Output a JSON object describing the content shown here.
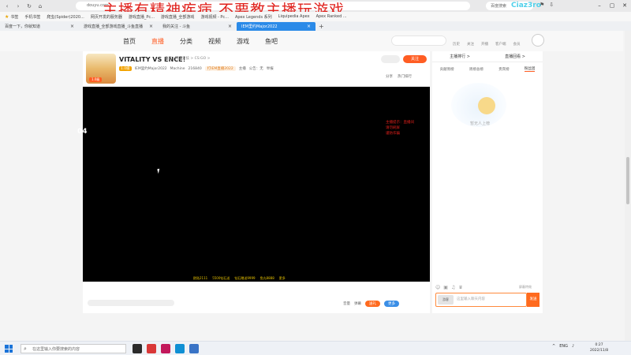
{
  "overlay": {
    "title": "主播有精神疾病 不要教主播玩游戏",
    "corner": "Ciaz3ro"
  },
  "browser": {
    "tabs": [
      {
        "label": "鼠标..."
      },
      {
        "label": "Apex Legends 系列"
      },
      {
        "label": "Liquipedia Apex"
      },
      {
        "label": "Apex Ranked ..."
      }
    ],
    "address": "douyu.com",
    "search_label": "百度搜索",
    "bookmarks": [
      {
        "label": "书签"
      },
      {
        "label": "手机书签"
      },
      {
        "label": "爬虫(Spider)2020..."
      },
      {
        "label": "网页开发的服务器"
      },
      {
        "label": "游戏直播_Pc..."
      },
      {
        "label": "游戏直播_全部游戏"
      },
      {
        "label": "游戏视频 - Pc..."
      },
      {
        "label": "Apex Legends 系列"
      },
      {
        "label": "Liquipedia Apex"
      },
      {
        "label": "Apex Ranked ..."
      }
    ],
    "page_tabs": [
      {
        "label": "百度一下，你就知道"
      },
      {
        "label": "游戏直播_全部游戏直播_斗鱼直播"
      },
      {
        "label": "我的关注 - 斗鱼"
      },
      {
        "label": "IEM里约Major2022"
      }
    ]
  },
  "site": {
    "nav": [
      "首页",
      "直播",
      "分类",
      "视频",
      "游戏",
      "鱼吧"
    ],
    "nav_active_index": 1,
    "links": [
      "历史",
      "关注",
      "开播",
      "客户端",
      "会员"
    ]
  },
  "room": {
    "title": "VITALITY VS ENCE！",
    "meta": [
      "体育",
      "网游竞技 > CS:GO >"
    ],
    "level": "1.0级",
    "streamer": "IEM里约Major2022",
    "company": "Machine",
    "fans": "216840",
    "pill": "打IEM直播2022",
    "stats": [
      "主播",
      "公告：无"
    ],
    "report": "举报",
    "follow": "关注",
    "share": "分享",
    "hot_ranking": "热门排行"
  },
  "player": {
    "red_note": [
      "主播提示：直播间",
      "请勿刷屏",
      "谨防诈骗"
    ],
    "ticker": [
      "欧陆2111",
      "5500钻石送",
      "钻石赠送9999",
      "鱼丸8888",
      "更多"
    ],
    "side_number": "04"
  },
  "controls": {
    "volume": "音量",
    "danmaku": "弹幕",
    "gift": "送礼",
    "more": "更多"
  },
  "rightpanel": {
    "top": [
      "主播排行 >",
      "直播回看 >"
    ],
    "tabs": [
      "贡献周榜",
      "周榜总榜",
      "贵宾榜",
      "粉丝团"
    ],
    "active_tab_index": 3,
    "empty_text": "暂无人上榜",
    "toggle": "屏蔽特效",
    "chat_avatar": "游客",
    "chat_placeholder": "这里输入聊天内容",
    "send": "发送"
  },
  "taskbar": {
    "search_placeholder": "在这里输入你要搜索的内容",
    "lang": "ENG",
    "time": "0:27",
    "date": "2022/11/8"
  }
}
